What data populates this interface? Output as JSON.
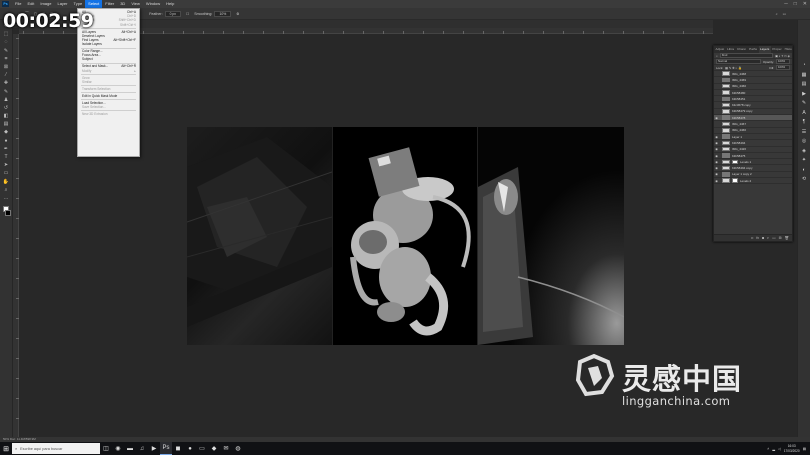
{
  "menubar": {
    "items": [
      "File",
      "Edit",
      "Image",
      "Layer",
      "Type",
      "Select",
      "Filter",
      "3D",
      "View",
      "Window",
      "Help"
    ],
    "active_index": 5,
    "app_logo": "Ps"
  },
  "options_bar": {
    "feather_label": "Feather:",
    "feather_value": "0 px",
    "smoothing_label": "Smoothing:",
    "smoothing_value": "10%"
  },
  "timer": "00:02:59",
  "select_menu": [
    {
      "label": "All",
      "shortcut": "Ctrl+A",
      "enabled": true
    },
    {
      "label": "Deselect",
      "shortcut": "Ctrl+D",
      "enabled": false
    },
    {
      "label": "Reselect",
      "shortcut": "Shift+Ctrl+D",
      "enabled": false
    },
    {
      "label": "Inverse",
      "shortcut": "Shift+Ctrl+I",
      "enabled": false
    },
    {
      "sep": true
    },
    {
      "label": "All Layers",
      "shortcut": "Alt+Ctrl+A",
      "enabled": true
    },
    {
      "label": "Deselect Layers",
      "shortcut": "",
      "enabled": true
    },
    {
      "label": "Find Layers",
      "shortcut": "Alt+Shift+Ctrl+F",
      "enabled": true
    },
    {
      "label": "Isolate Layers",
      "shortcut": "",
      "enabled": true
    },
    {
      "sep": true
    },
    {
      "label": "Color Range...",
      "shortcut": "",
      "enabled": true
    },
    {
      "label": "Focus Area...",
      "shortcut": "",
      "enabled": true
    },
    {
      "label": "Subject",
      "shortcut": "",
      "enabled": true
    },
    {
      "sep": true
    },
    {
      "label": "Select and Mask...",
      "shortcut": "Alt+Ctrl+R",
      "enabled": true
    },
    {
      "label": "Modify",
      "shortcut": "▸",
      "enabled": false
    },
    {
      "sep": true
    },
    {
      "label": "Grow",
      "shortcut": "",
      "enabled": false
    },
    {
      "label": "Similar",
      "shortcut": "",
      "enabled": false
    },
    {
      "sep": true
    },
    {
      "label": "Transform Selection",
      "shortcut": "",
      "enabled": false
    },
    {
      "sep": true
    },
    {
      "label": "Edit in Quick Mask Mode",
      "shortcut": "",
      "enabled": true
    },
    {
      "sep": true
    },
    {
      "label": "Load Selection...",
      "shortcut": "",
      "enabled": true
    },
    {
      "label": "Save Selection...",
      "shortcut": "",
      "enabled": false
    },
    {
      "sep": true
    },
    {
      "label": "New 3D Extrusion",
      "shortcut": "",
      "enabled": false
    }
  ],
  "layers_panel": {
    "tabs": [
      "Adjust",
      "Libra",
      "Chann",
      "Paths",
      "Layers",
      "Proper",
      "Histo"
    ],
    "active_tab": 4,
    "filter_kind": "Kind",
    "blend_mode": "Normal",
    "opacity_label": "Opacity:",
    "opacity_value": "100%",
    "lock_label": "Lock:",
    "fill_label": "Fill:",
    "fill_value": "100%",
    "layers": [
      {
        "name": "IMG_4468",
        "visible": false,
        "mask": false,
        "selected": false
      },
      {
        "name": "IMG_4469",
        "visible": false,
        "mask": false,
        "selected": false
      },
      {
        "name": "IMG_4460",
        "visible": false,
        "mask": false,
        "selected": false
      },
      {
        "name": "b3b58480",
        "visible": false,
        "mask": false,
        "selected": false
      },
      {
        "name": "b3b58451",
        "visible": false,
        "mask": false,
        "selected": false
      },
      {
        "name": "b3c3678 copy",
        "visible": false,
        "mask": false,
        "selected": false
      },
      {
        "name": "b3b58479 copy",
        "visible": false,
        "mask": false,
        "selected": false
      },
      {
        "name": "b3b58478",
        "visible": true,
        "mask": false,
        "selected": true
      },
      {
        "name": "IMG_4467",
        "visible": false,
        "mask": false,
        "selected": false
      },
      {
        "name": "IMG_4466",
        "visible": false,
        "mask": false,
        "selected": false
      },
      {
        "name": "Layer 1",
        "visible": true,
        "mask": false,
        "selected": false
      },
      {
        "name": "b3b58494",
        "visible": true,
        "mask": false,
        "selected": false
      },
      {
        "name": "IMG_4426",
        "visible": true,
        "mask": false,
        "selected": false
      },
      {
        "name": "b3b58475",
        "visible": true,
        "mask": false,
        "selected": false
      },
      {
        "name": "Levels 1",
        "visible": true,
        "mask": true,
        "selected": false
      },
      {
        "name": "b3b58494 copy",
        "visible": true,
        "mask": false,
        "selected": false
      },
      {
        "name": "Layer 1 copy 2",
        "visible": true,
        "mask": false,
        "selected": false
      },
      {
        "name": "Levels 2",
        "visible": true,
        "mask": true,
        "selected": false
      }
    ]
  },
  "statusbar": {
    "text": "50%   Doc: 11.4M/598.9M"
  },
  "taskbar": {
    "search_placeholder": "Escribe aquí para buscar",
    "time": "16:03",
    "date": "17/03/2020"
  },
  "watermark": {
    "chinese": "灵感中国",
    "english": "lingganchina.com"
  },
  "colors": {
    "menu_highlight": "#1473e6",
    "watermark": "#ffffff"
  }
}
